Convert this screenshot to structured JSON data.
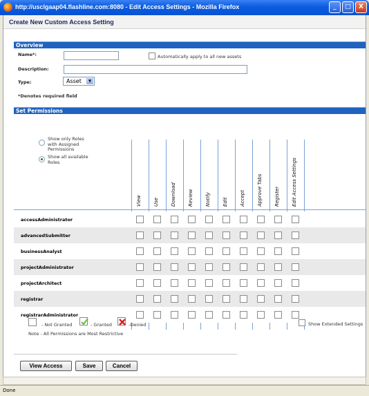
{
  "window": {
    "title": "http://usclgaap04.flashline.com:8080 - Edit Access Settings - Mozilla Firefox",
    "min": "_",
    "max": "□",
    "close": "X"
  },
  "dialog": {
    "title": "Create New Custom Access Setting"
  },
  "overview": {
    "header": "Overview",
    "name_label": "Name*:",
    "name_value": "",
    "auto_apply_label": "Automatically apply to all new assets",
    "description_label": "Description:",
    "description_value": "",
    "type_label": "Type:",
    "type_value": "Asset",
    "required_note": "*Denotes required field"
  },
  "permissions": {
    "header": "Set Permissions",
    "radio_1": "Show only Roles with Assigned Permissions",
    "radio_2": "Show all available Roles",
    "radio_selected": 2,
    "columns": [
      "View",
      "Use",
      "Download",
      "Review",
      "Notify",
      "Edit",
      "Accept",
      "Approve Tabs",
      "Register",
      "Edit Access Settings"
    ],
    "roles": [
      "accessAdministrator",
      "advancedSubmitter",
      "businessAnalyst",
      "projectAdministrator",
      "projectArchitect",
      "registrar",
      "registrarAdministrator"
    ]
  },
  "legend": {
    "not_granted": "- Not Granted",
    "granted": "- Granted",
    "denied": "-Denied",
    "note": "Note - All Permissions are Most Restrictive",
    "extended": "Show Extended Settings"
  },
  "buttons": {
    "view_access": "View Access",
    "save": "Save",
    "cancel": "Cancel"
  },
  "statusbar": {
    "text": "Done"
  },
  "colors": {
    "section_header": "#1f62c0",
    "grid_line": "#7aa0d8",
    "granted": "#6ac23a",
    "denied": "#d32020"
  },
  "icons": [
    "firefox-icon",
    "minimize-icon",
    "maximize-icon",
    "close-icon",
    "dropdown-arrow-icon",
    "granted-check-icon",
    "denied-x-icon"
  ]
}
